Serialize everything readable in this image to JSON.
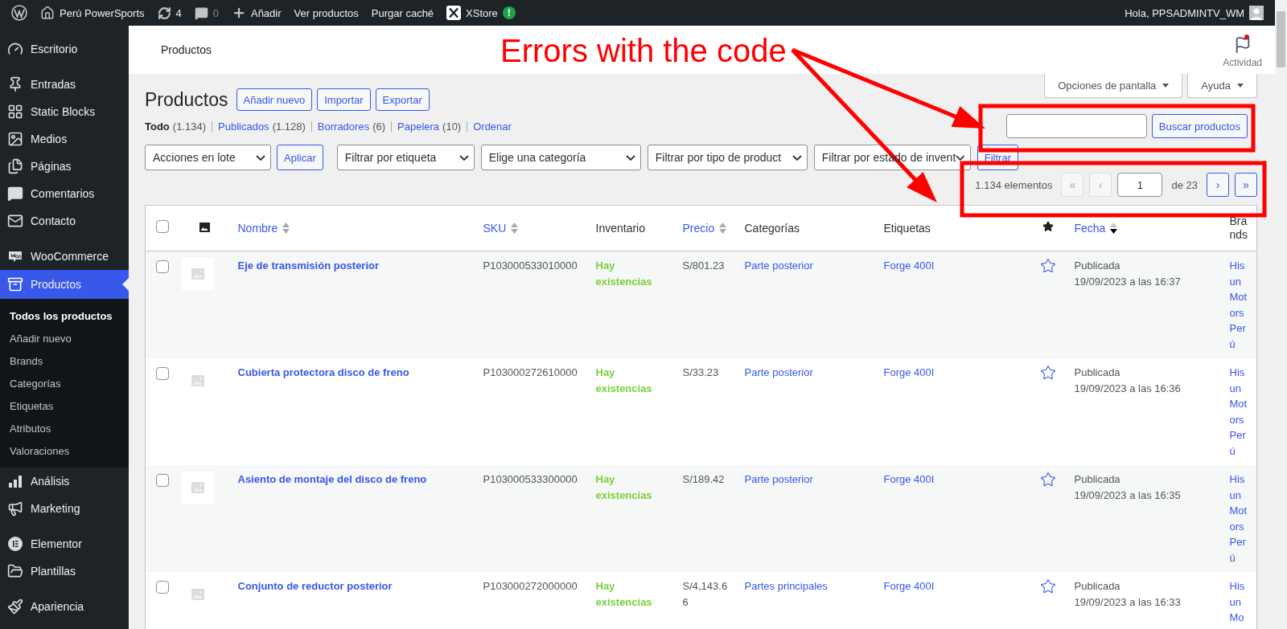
{
  "admin_bar": {
    "site": "Perú PowerSports",
    "updates": "4",
    "comments": "0",
    "new": "Añadir",
    "links": [
      "Ver productos",
      "Purgar caché"
    ],
    "xstore": "XStore",
    "xstore_alert": "!",
    "greeting": "Hola, PPSADMINTV_WM"
  },
  "sidebar": {
    "groups": [
      [
        {
          "label": "Escritorio",
          "selected": false
        }
      ],
      [
        {
          "label": "Entradas",
          "selected": false
        },
        {
          "label": "Static Blocks",
          "selected": false
        },
        {
          "label": "Medios",
          "selected": false
        },
        {
          "label": "Páginas",
          "selected": false
        },
        {
          "label": "Comentarios",
          "selected": false
        },
        {
          "label": "Contacto",
          "selected": false
        }
      ],
      [
        {
          "label": "WooCommerce",
          "selected": false
        },
        {
          "label": "Productos",
          "selected": true,
          "children": [
            {
              "label": "Todos los productos",
              "selected": true
            },
            {
              "label": "Añadir nuevo",
              "selected": false
            },
            {
              "label": "Brands",
              "selected": false
            },
            {
              "label": "Categorías",
              "selected": false
            },
            {
              "label": "Etiquetas",
              "selected": false
            },
            {
              "label": "Atributos",
              "selected": false
            },
            {
              "label": "Valoraciones",
              "selected": false
            }
          ]
        },
        {
          "label": "Análisis",
          "selected": false
        },
        {
          "label": "Marketing",
          "selected": false
        }
      ],
      [
        {
          "label": "Elementor",
          "selected": false
        },
        {
          "label": "Plantillas",
          "selected": false
        }
      ],
      [
        {
          "label": "Apariencia",
          "selected": false
        }
      ]
    ]
  },
  "header": {
    "title": "Productos",
    "activity": "Actividad",
    "activity_unread": true
  },
  "screen_tabs": [
    "Opciones de pantalla",
    "Ayuda"
  ],
  "page": {
    "title": "Productos",
    "actions": [
      "Añadir nuevo",
      "Importar",
      "Exportar"
    ]
  },
  "views": [
    {
      "label": "Todo",
      "count": "(1.134)",
      "selected": true
    },
    {
      "label": "Publicados",
      "count": "(1.128)",
      "selected": false
    },
    {
      "label": "Borradores",
      "count": "(6)",
      "selected": false
    },
    {
      "label": "Papelera",
      "count": "(10)",
      "selected": false
    },
    {
      "label": "Ordenar",
      "selected": false
    }
  ],
  "search": {
    "button": "Buscar productos"
  },
  "bulk": {
    "select": "Acciones en lote",
    "button": "Aplicar"
  },
  "filters": {
    "selects": [
      "Filtrar por etiqueta",
      "Elige una categoría",
      "Filtrar por tipo de product",
      "Filtrar por estado de invent"
    ],
    "button": "Filtrar"
  },
  "pagination": {
    "count": "1.134 elementos",
    "current": "1",
    "total": "de 23",
    "buttons": [
      {
        "label": "«",
        "disabled": true
      },
      {
        "label": "‹",
        "disabled": true
      },
      {
        "label": "›",
        "disabled": false
      },
      {
        "label": "»",
        "disabled": false
      }
    ]
  },
  "table": {
    "columns": [
      {
        "kind": "checkbox",
        "checked": false
      },
      {
        "kind": "image"
      },
      {
        "kind": "text",
        "label": "Nombre",
        "sortable": true,
        "sorted": false
      },
      {
        "kind": "text",
        "label": "SKU",
        "sortable": true,
        "sorted": false
      },
      {
        "kind": "text",
        "label": "Inventario",
        "sortable": false,
        "sorted": false
      },
      {
        "kind": "text",
        "label": "Precio",
        "sortable": true,
        "sorted": false
      },
      {
        "kind": "text",
        "label": "Categorías",
        "sortable": false,
        "sorted": false
      },
      {
        "kind": "text",
        "label": "Etiquetas",
        "sortable": false,
        "sorted": false
      },
      {
        "kind": "star"
      },
      {
        "kind": "text",
        "label": "Fecha",
        "sortable": true,
        "sorted": true
      },
      {
        "kind": "text",
        "label": "Brands",
        "sortable": false,
        "sorted": false
      }
    ],
    "rows": [
      {
        "checked": false,
        "name": "Eje de transmisión posterior",
        "sku": "P103000533010000",
        "stock": "Hay existencias",
        "in_stock": true,
        "price": "S/801.23",
        "category": "Parte posterior",
        "tag": "Forge 400I",
        "featured": false,
        "status": "Publicada",
        "date": "19/09/2023 a las 16:37",
        "brand": "Hisun Motors Perú"
      },
      {
        "checked": false,
        "name": "Cubierta protectora disco de freno",
        "sku": "P103000272610000",
        "stock": "Hay existencias",
        "in_stock": true,
        "price": "S/33.23",
        "category": "Parte posterior",
        "tag": "Forge 400I",
        "featured": false,
        "status": "Publicada",
        "date": "19/09/2023 a las 16:36",
        "brand": "Hisun Motors Perú"
      },
      {
        "checked": false,
        "name": "Asiento de montaje del disco de freno",
        "sku": "P103000533300000",
        "stock": "Hay existencias",
        "in_stock": true,
        "price": "S/189.42",
        "category": "Parte posterior",
        "tag": "Forge 400I",
        "featured": false,
        "status": "Publicada",
        "date": "19/09/2023 a las 16:35",
        "brand": "Hisun Motors Perú"
      },
      {
        "checked": false,
        "name": "Conjunto de reductor posterior",
        "sku": "P103000272000000",
        "stock": "Hay existencias",
        "in_stock": true,
        "price": "S/4,143.66",
        "category": "Partes principales",
        "tag": "Forge 400I",
        "featured": false,
        "status": "Publicada",
        "date": "19/09/2023 a las 16:33",
        "brand": "Hisun Mo"
      }
    ]
  },
  "annotation": {
    "text": "Errors with the code"
  }
}
